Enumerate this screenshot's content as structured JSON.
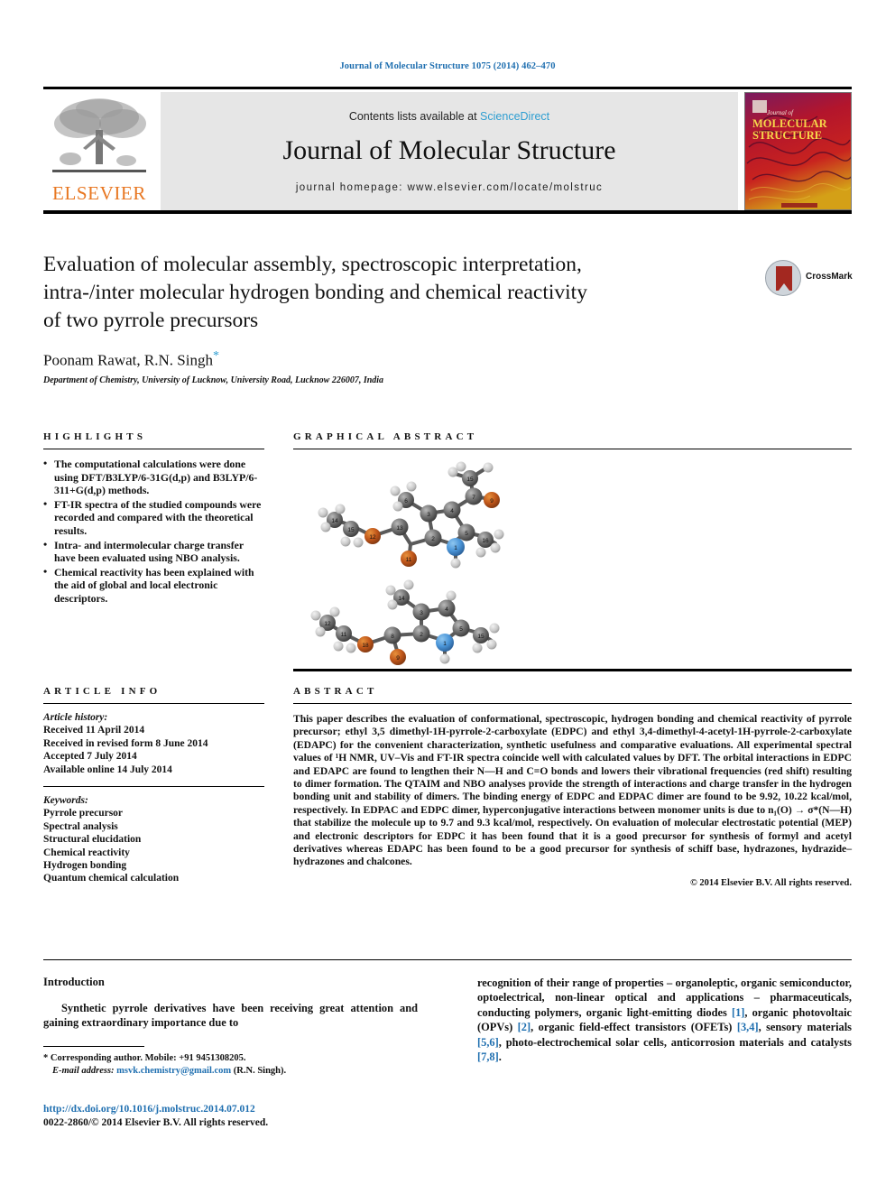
{
  "running_head": "Journal of Molecular Structure 1075 (2014) 462–470",
  "masthead": {
    "contents_prefix": "Contents lists available at ",
    "contents_link": "ScienceDirect",
    "journal_name": "Journal of Molecular Structure",
    "homepage": "journal homepage: www.elsevier.com/locate/molstruc",
    "publisher_wordmark": "ELSEVIER",
    "cover_journal_word": "Journal of",
    "cover_title_line1": "MOLECULAR",
    "cover_title_line2": "STRUCTURE"
  },
  "title": {
    "line1": "Evaluation of molecular assembly, spectroscopic interpretation,",
    "line2": "intra-/inter molecular hydrogen bonding and chemical reactivity",
    "line3": "of two pyrrole precursors",
    "authors": "Poonam Rawat, R.N. Singh",
    "author_marker": "*",
    "affiliation": "Department of Chemistry, University of Lucknow, University Road, Lucknow 226007, India"
  },
  "crossmark": {
    "label": "CrossMark"
  },
  "highlights": {
    "heading": "HIGHLIGHTS",
    "items": [
      "The computational calculations were done using DFT/B3LYP/6-31G(d,p) and B3LYP/6-311+G(d,p) methods.",
      "FT-IR spectra of the studied compounds were recorded and compared with the theoretical results.",
      "Intra- and intermolecular charge transfer have been evaluated using NBO analysis.",
      "Chemical reactivity has been explained with the aid of global and local electronic descriptors."
    ]
  },
  "graphical_abstract": {
    "heading": "GRAPHICAL ABSTRACT",
    "figure_description": "Two ball-and-stick molecular models of pyrrole precursors with numbered atoms",
    "molecule_top_label": "EDAPC molecular model",
    "molecule_bottom_label": "EDPC molecular model"
  },
  "article_info": {
    "heading": "ARTICLE INFO",
    "history_label": "Article history:",
    "history": [
      "Received 11 April 2014",
      "Received in revised form 8 June 2014",
      "Accepted 7 July 2014",
      "Available online 14 July 2014"
    ],
    "keywords_label": "Keywords:",
    "keywords": [
      "Pyrrole precursor",
      "Spectral analysis",
      "Structural elucidation",
      "Chemical reactivity",
      "Hydrogen bonding",
      "Quantum chemical calculation"
    ]
  },
  "abstract": {
    "heading": "ABSTRACT",
    "body": "This paper describes the evaluation of conformational, spectroscopic, hydrogen bonding and chemical reactivity of pyrrole precursor; ethyl 3,5 dimethyl-1H-pyrrole-2-carboxylate (EDPC) and ethyl 3,4-dimethyl-4-acetyl-1H-pyrrole-2-carboxylate (EDAPC) for the convenient characterization, synthetic usefulness and comparative evaluations. All experimental spectral values of ¹H NMR, UV–Vis and FT-IR spectra coincide well with calculated values by DFT. The orbital interactions in EDPC and EDAPC are found to lengthen their N—H and C=O bonds and lowers their vibrational frequencies (red shift) resulting to dimer formation. The QTAIM and NBO analyses provide the strength of interactions and charge transfer in the hydrogen bonding unit and stability of dimers. The binding energy of EDPC and EDPAC dimer are found to be 9.92, 10.22 kcal/mol, respectively. In EDPAC and EDPC dimer, hyperconjugative interactions between monomer units is due to n₁(O) → σ*(N—H) that stabilize the molecule up to 9.7 and 9.3 kcal/mol, respectively. On evaluation of molecular electrostatic potential (MEP) and electronic descriptors for EDPC it has been found that it is a good precursor for synthesis of formyl and acetyl derivatives whereas EDAPC has been found to be a good precursor for synthesis of schiff base, hydrazones, hydrazide–hydrazones and chalcones.",
    "copyright": "© 2014 Elsevier B.V. All rights reserved."
  },
  "body": {
    "section_heading": "Introduction",
    "left_paragraph": "Synthetic pyrrole derivatives have been receiving great attention and gaining extraordinary importance due to",
    "right_paragraph_part1": "recognition of their range of properties – organoleptic, organic semiconductor, optoelectrical, non-linear optical and applications – pharmaceuticals, conducting polymers, organic light-emitting diodes ",
    "ref1": "[1]",
    "right_paragraph_part2": ", organic photovoltaic (OPVs) ",
    "ref2": "[2]",
    "right_paragraph_part3": ", organic field-effect transistors (OFETs) ",
    "ref3": "[3,4]",
    "right_paragraph_part4": ", sensory materials ",
    "ref4": "[5,6]",
    "right_paragraph_part5": ", photo-electrochemical solar cells, anticorrosion materials and catalysts ",
    "ref5": "[7,8]",
    "right_paragraph_part6": "."
  },
  "footnote": {
    "marker": "*",
    "corresponding": "Corresponding author. Mobile: +91 9451308205.",
    "email_label": "E-mail address:",
    "email": "msvk.chemistry@gmail.com",
    "email_owner": "(R.N. Singh).",
    "doi": "http://dx.doi.org/10.1016/j.molstruc.2014.07.012",
    "issn": "0022-2860/© 2014 Elsevier B.V. All rights reserved."
  },
  "colors": {
    "link_blue": "#1f6fb0",
    "sciencedirect_blue": "#2e9ed1",
    "elsevier_orange": "#e87722",
    "band_gray": "#e6e6e6",
    "crossmark_red": "#a32820"
  }
}
